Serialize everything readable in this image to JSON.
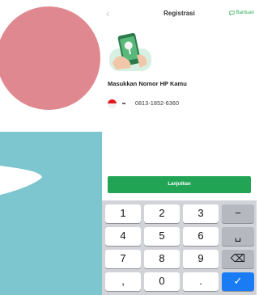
{
  "app": {
    "title": "Registrasi",
    "help_label": "Bantuan"
  },
  "form": {
    "heading": "Masukkan Nomor HP Kamu",
    "phone_number": "0813-1852-6360",
    "country": "Indonesia"
  },
  "actions": {
    "continue_label": "Lanjutkan"
  },
  "keyboard": {
    "rows": [
      [
        "1",
        "2",
        "3",
        "−"
      ],
      [
        "4",
        "5",
        "6",
        "␣"
      ],
      [
        "7",
        "8",
        "9",
        "⌫"
      ],
      [
        ",",
        "0",
        ".",
        "✓"
      ]
    ]
  },
  "colors": {
    "accent": "#22a455",
    "decor_pink": "#e0888f",
    "decor_teal": "#7ec6cf",
    "keyboard_done": "#1a7cf5"
  }
}
